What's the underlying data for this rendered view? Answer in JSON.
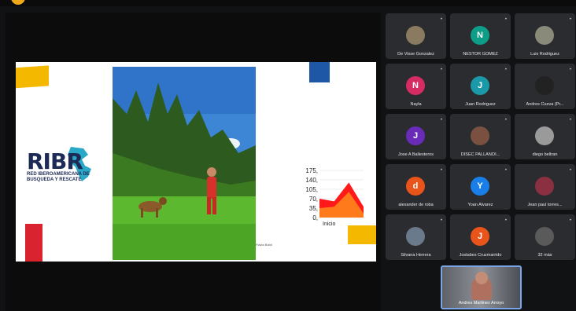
{
  "slide": {
    "logo_main": "RIBR",
    "logo_sub": "RED IBEROAMERICANA DE BUSQUEDA Y RESCATE",
    "credit_text": "Flavia Baldi"
  },
  "chart_data": {
    "type": "area",
    "y_ticks": [
      "175,",
      "140,",
      "105,",
      "70,",
      "35,",
      "0,"
    ],
    "x_label": "Inicio",
    "ylim": [
      0,
      175
    ],
    "series": [
      {
        "values": [
          70,
          60,
          130,
          40
        ],
        "color": "#ff1a1a"
      },
      {
        "values": [
          35,
          40,
          95,
          15
        ],
        "color": "#ff7a1a"
      }
    ]
  },
  "participants": [
    {
      "name": "De Visse Gonzalez",
      "initial": "",
      "color": "#8a7a60",
      "photo": true
    },
    {
      "name": "NESTOR GOMEZ",
      "initial": "N",
      "color": "#0e9e88",
      "photo": false
    },
    {
      "name": "Luis Rodriguez",
      "initial": "",
      "color": "#8a8a7a",
      "photo": true
    },
    {
      "name": "Nayla",
      "initial": "N",
      "color": "#d62b63",
      "photo": false
    },
    {
      "name": "Juan Rodriguez",
      "initial": "J",
      "color": "#1a9aa8",
      "photo": false
    },
    {
      "name": "Andres Cueva (Pr...",
      "initial": "",
      "color": "#222222",
      "photo": true
    },
    {
      "name": "Jose A Ballesteros",
      "initial": "J",
      "color": "#6a2bb8",
      "photo": false
    },
    {
      "name": "DISEC PALLANOI...",
      "initial": "",
      "color": "#7a5040",
      "photo": true
    },
    {
      "name": "diego beltran",
      "initial": "",
      "color": "#9a9a9a",
      "photo": true
    },
    {
      "name": "alexander de roba",
      "initial": "d",
      "color": "#e8541a",
      "photo": false
    },
    {
      "name": "Yoan Alvarez",
      "initial": "Y",
      "color": "#1a7ee8",
      "photo": false
    },
    {
      "name": "Jean paul torres...",
      "initial": "",
      "color": "#8a3040",
      "photo": true
    },
    {
      "name": "Silvana Herrera",
      "initial": "",
      "color": "#6a7a8a",
      "photo": true
    },
    {
      "name": "Jostabes Cruzmarrido",
      "initial": "J",
      "color": "#e8541a",
      "photo": false
    },
    {
      "name": "32 más",
      "initial": "",
      "color": "#5a5a5a",
      "photo": true
    }
  ],
  "self_view": {
    "name": "Andres Martinez Arroyo"
  },
  "icons": {
    "mic": "mic-muted-icon"
  }
}
